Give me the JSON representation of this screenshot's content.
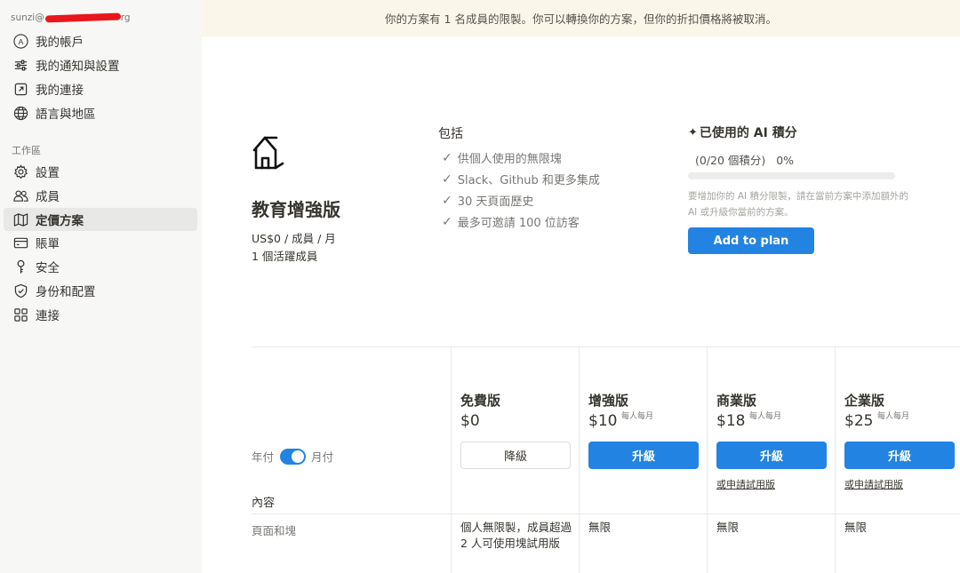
{
  "sidebar": {
    "email_prefix": "sunzi@",
    "email_suffix": "rg",
    "account_items": [
      {
        "label": "我的帳戶",
        "icon": "account-circle-icon"
      },
      {
        "label": "我的通知與設置",
        "icon": "sliders-icon"
      },
      {
        "label": "我的連接",
        "icon": "external-link-icon"
      },
      {
        "label": "語言與地區",
        "icon": "globe-icon"
      }
    ],
    "workspace_title": "工作區",
    "workspace_items": [
      {
        "label": "設置",
        "icon": "gear-icon"
      },
      {
        "label": "成員",
        "icon": "people-icon"
      },
      {
        "label": "定價方案",
        "icon": "map-icon"
      },
      {
        "label": "賬單",
        "icon": "credit-card-icon"
      },
      {
        "label": "安全",
        "icon": "key-icon"
      },
      {
        "label": "身份和配置",
        "icon": "shield-check-icon"
      },
      {
        "label": "連接",
        "icon": "grid-icon"
      }
    ]
  },
  "banner": {
    "text": "你的方案有 1 名成員的限製。你可以轉換你的方案，但你的折扣價格將被取消。"
  },
  "current_plan": {
    "name": "教育增強版",
    "price": "US$0 / 成員 / 月",
    "members": "1 個活躍成員",
    "includes_title": "包括",
    "includes": [
      "供個人使用的無限塊",
      "Slack、Github 和更多集成",
      "30 天頁面歷史",
      "最多可邀請 100 位訪客"
    ]
  },
  "ai": {
    "title": "已使用的 AI 積分",
    "usage": "(0/20 個積分)   0%",
    "progress_fraction": 0,
    "note": "要增加你的 AI 積分限製，請在當前方案中添加額外的 AI 或升級你當前的方案。",
    "add_button": "Add to plan"
  },
  "billing": {
    "yearly": "年付",
    "monthly": "月付"
  },
  "table": {
    "content_label": "內容",
    "row_label": "頁面和塊",
    "tiers": [
      {
        "name": "免費版",
        "price": "$0",
        "per": "",
        "button": "降級",
        "trial": "",
        "pages": "個人無限製，成員超過 2 人可使用塊試用版"
      },
      {
        "name": "增強版",
        "price": "$10",
        "per": "每人每月",
        "button": "升級",
        "trial": "",
        "pages": "無限"
      },
      {
        "name": "商業版",
        "price": "$18",
        "per": "每人每月",
        "button": "升級",
        "trial": "或申請試用版",
        "pages": "無限"
      },
      {
        "name": "企業版",
        "price": "$25",
        "per": "每人每月",
        "button": "升級",
        "trial": "或申請試用版",
        "pages": "無限"
      }
    ]
  },
  "colors": {
    "accent": "#2383e2",
    "banner_bg": "#fbf6ea",
    "sidebar_bg": "#f7f7f5"
  }
}
